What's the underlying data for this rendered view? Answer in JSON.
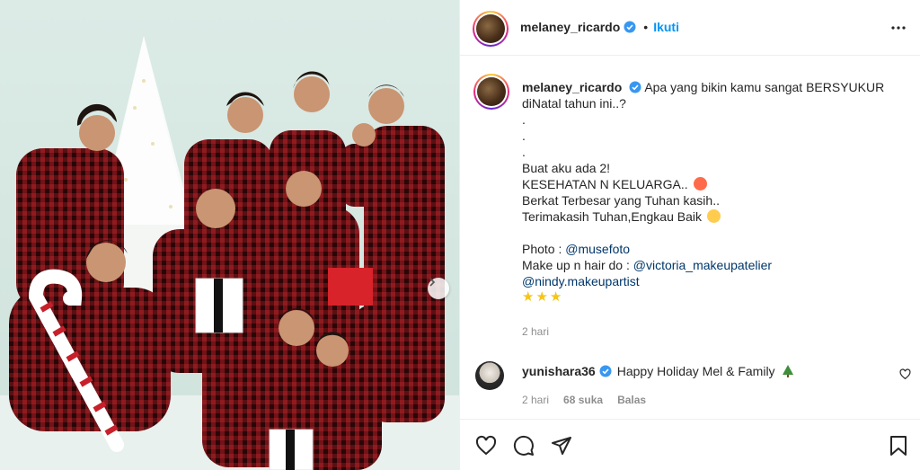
{
  "post": {
    "username": "melaney_ricardo",
    "follow_label": "Ikuti",
    "dot": "•",
    "image_alt": "Family photo in matching red plaid Christmas pajamas"
  },
  "caption": {
    "username": "melaney_ricardo",
    "lines": [
      "Apa yang bikin kamu sangat BERSYUKUR",
      "diNatal tahun ini..?",
      ".",
      ".",
      ".",
      "Buat aku ada 2!",
      "KESEHATAN N KELUARGA..",
      "Berkat Terbesar yang Tuhan kasih..",
      "Terimakasih Tuhan,Engkau Baik",
      "",
      "Photo : ",
      "Make up n hair do : ",
      "@nindy.makeupartist",
      "★★★"
    ],
    "link_photo": "@musefoto",
    "link_makeup": "@victoria_makeupatelier",
    "time": "2 hari"
  },
  "comment": {
    "username": "yunishara36",
    "text": "Happy Holiday Mel & Family",
    "time": "2 hari",
    "likes": "68 suka",
    "reply": "Balas"
  },
  "colors": {
    "accent": "#0095f6",
    "link": "#00376b",
    "muted": "#8e8e8e",
    "verified": "#3897f0"
  },
  "icons": [
    "verified-badge-icon",
    "more-options-icon",
    "next-arrow-icon",
    "heart-icon",
    "comment-icon",
    "share-icon",
    "save-icon",
    "christmas-tree-icon"
  ]
}
